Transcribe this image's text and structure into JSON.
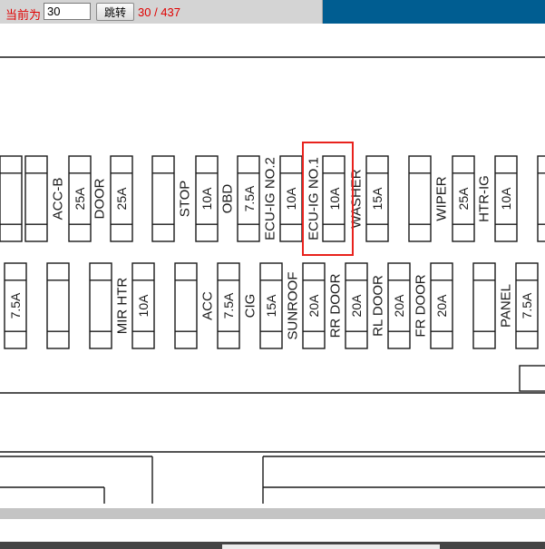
{
  "nav": {
    "current_label": "当前为",
    "page_value": "30",
    "jump_button": "跳转",
    "page_counter": "30 / 437"
  },
  "diagram": {
    "top_row": {
      "labels": [
        "ACC-B",
        "DOOR",
        "STOP",
        "OBD",
        "ECU-IG NO.2",
        "ECU-IG NO.1",
        "WASHER",
        "WIPER",
        "HTR-IG"
      ],
      "ratings": [
        "25A",
        "25A",
        "10A",
        "7.5A",
        "10A",
        "10A",
        "15A",
        "25A",
        "10A"
      ]
    },
    "bottom_row": {
      "labels": [
        "MIR HTR",
        "ACC",
        "CIG",
        "SUNROOF",
        "RR DOOR",
        "RL DOOR",
        "FR DOOR",
        "PANEL"
      ],
      "ratings": [
        "7.5A",
        "10A",
        "7.5A",
        "15A",
        "20A",
        "20A",
        "20A",
        "20A",
        "7.5A"
      ]
    },
    "highlighted_fuse": "ECU-IG NO.1",
    "highlight_color": "#e8221d"
  }
}
